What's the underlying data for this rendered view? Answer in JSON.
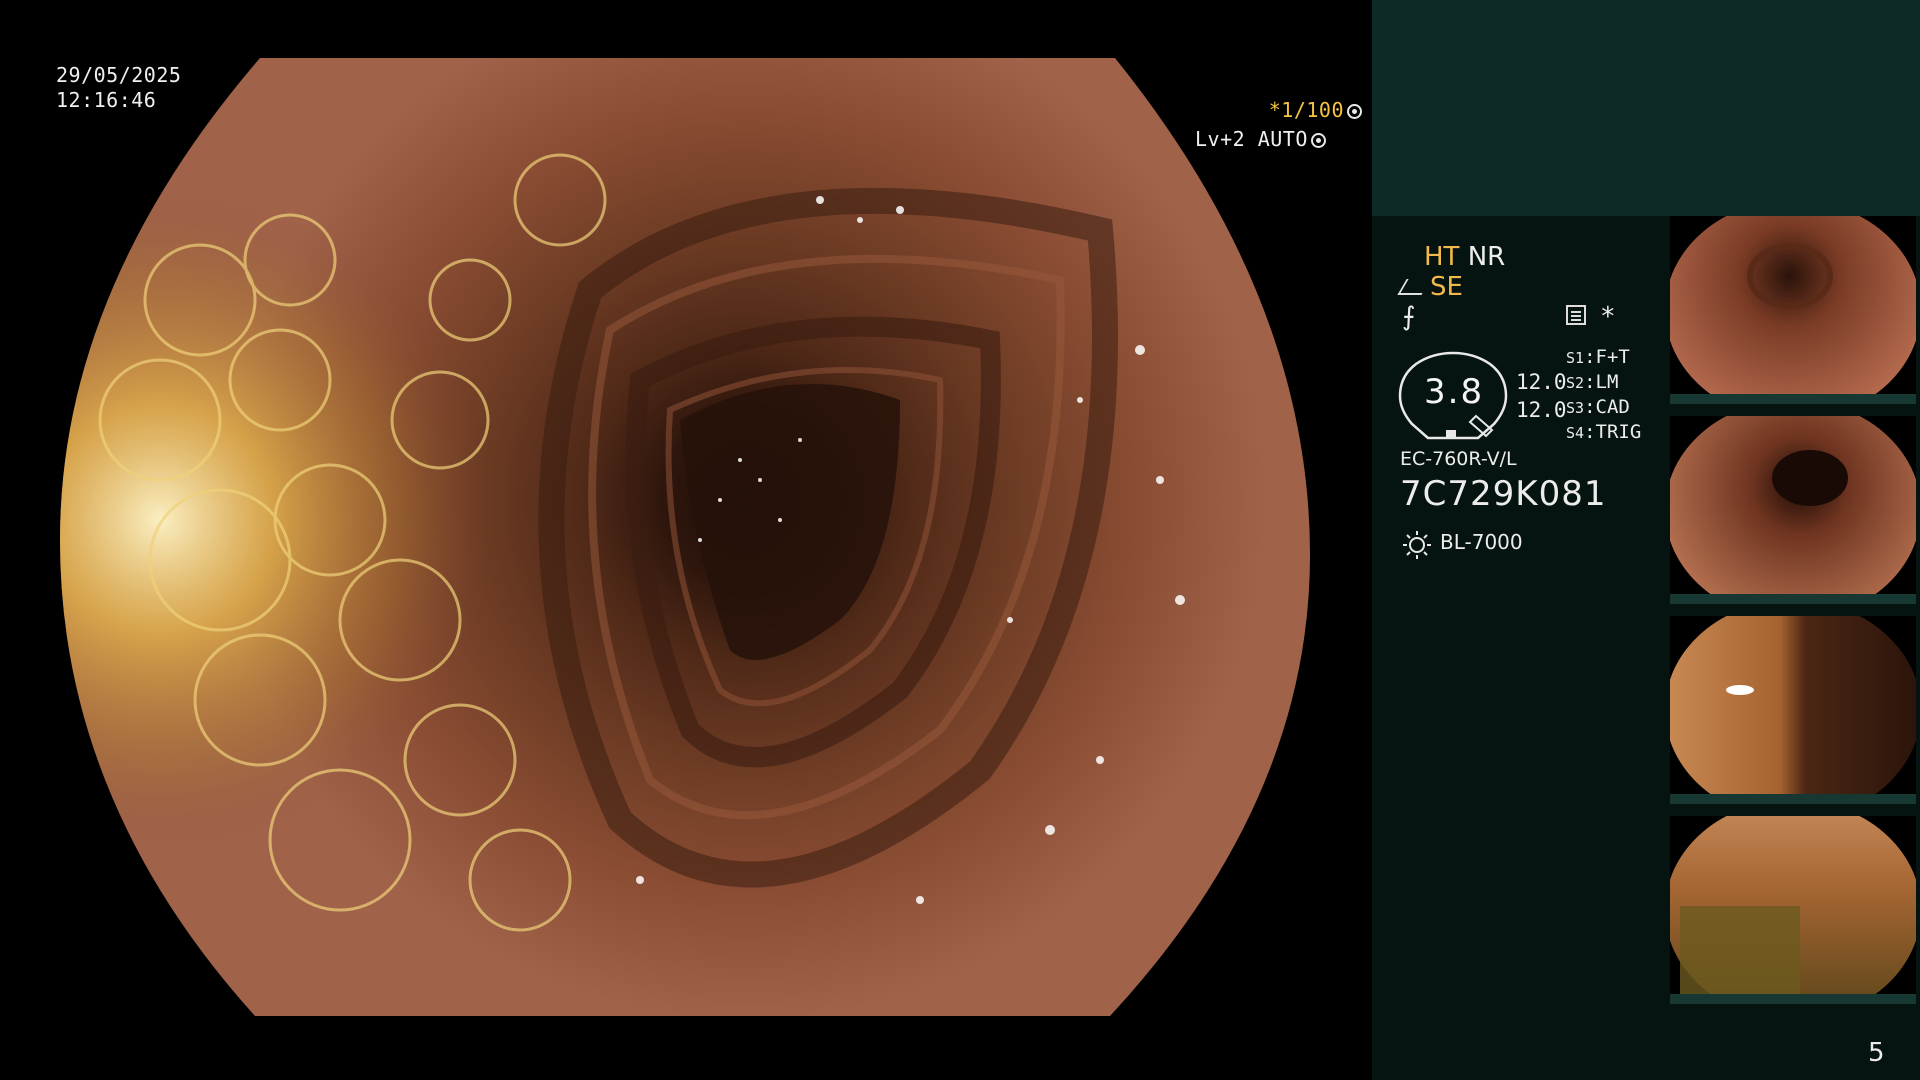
{
  "osd": {
    "date": "29/05/2025",
    "time": "12:16:46",
    "shutter_star": "*",
    "shutter": "1/100",
    "level": "Lv+2 AUTO"
  },
  "panel": {
    "ht": "HT",
    "nr": "NR",
    "se": "SE",
    "f_symbol": "⨍",
    "star": "*",
    "gauge_value": "3.8",
    "value_a": "12.0",
    "value_b": "12.0",
    "switches": [
      {
        "id": "S1",
        "label": "F+T"
      },
      {
        "id": "S2",
        "label": "LM"
      },
      {
        "id": "S3",
        "label": "CAD"
      },
      {
        "id": "S4",
        "label": "TRIG"
      }
    ],
    "scope_model": "EC-760R-V/L",
    "serial": "7C729K081",
    "light_source": "BL-7000",
    "page_number": "5"
  },
  "colors": {
    "panel_bg": "#061411",
    "panel_top": "#0e2a27",
    "accent_orange": "#f2b94b",
    "mucosa": "#8a4a32"
  }
}
